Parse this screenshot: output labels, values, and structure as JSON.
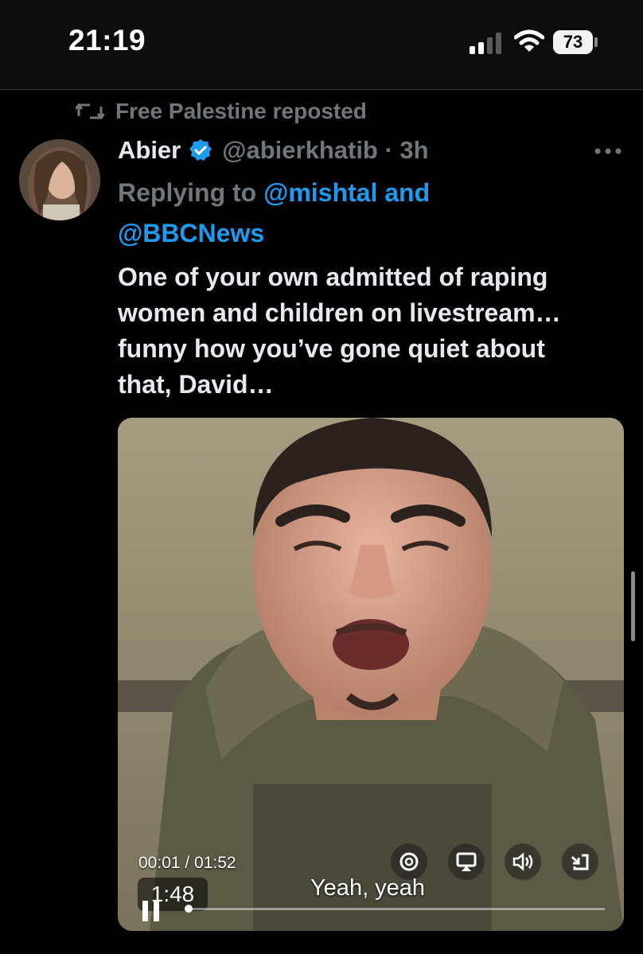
{
  "status_bar": {
    "time": "21:19",
    "battery": "73"
  },
  "tweet": {
    "reposted_by": "Free Palestine reposted",
    "author_name": "Abier",
    "handle_time": "@abierkhatib · 3h",
    "replying_prefix": "Replying to ",
    "replying_mention_1": "@mishtal and",
    "replying_mention_2": "@BBCNews",
    "text_lines": [
      "One of your own admitted of raping",
      "women and children on livestream…",
      "funny how you’ve gone quiet about",
      "that, David…"
    ]
  },
  "video": {
    "timestamp": "00:01 / 01:52",
    "remaining": "1:48",
    "caption": "Yeah, yeah",
    "progress_fraction": 0.01
  },
  "colors": {
    "background": "#000000",
    "muted": "#71767b",
    "accent": "#1d9bf0",
    "text": "#e7e9ea"
  },
  "icons": [
    "repost-icon",
    "verified-badge-icon",
    "more-icon",
    "settings-icon",
    "airplay-icon",
    "volume-icon",
    "exit-fullscreen-icon",
    "pause-icon",
    "wifi-icon",
    "signal-icon",
    "battery-icon"
  ]
}
